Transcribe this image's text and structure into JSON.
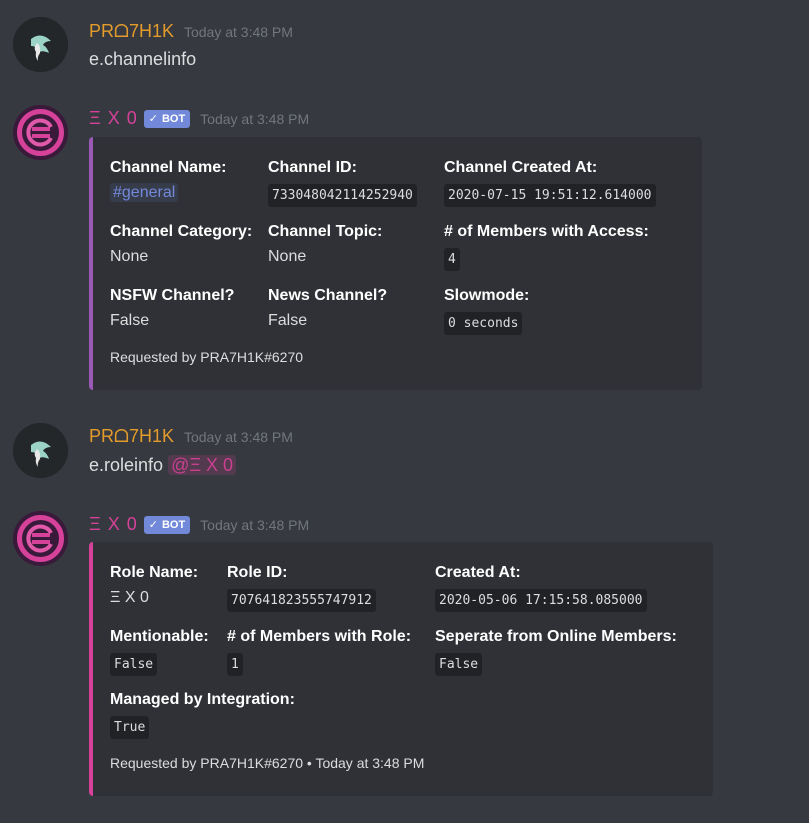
{
  "messages": [
    {
      "author": "PRᴗᴥH1K",
      "author_display": "PRᗝ7H1K",
      "timestamp": "Today at 3:48 PM",
      "content": "e.channelinfo"
    },
    {
      "author": "Ξ X 0",
      "bot_tag": "BOT",
      "timestamp": "Today at 3:48 PM",
      "embed": {
        "fields": [
          {
            "name": "Channel Name:",
            "value": "#general"
          },
          {
            "name": "Channel ID:",
            "value": "733048042114252940"
          },
          {
            "name": "Channel Created At:",
            "value": "2020-07-15 19:51:12.614000"
          },
          {
            "name": "Channel Category:",
            "value": "None"
          },
          {
            "name": "Channel Topic:",
            "value": "None"
          },
          {
            "name": "# of Members with Access:",
            "value": "4"
          },
          {
            "name": "NSFW Channel?",
            "value": "False"
          },
          {
            "name": "News Channel?",
            "value": "False"
          },
          {
            "name": "Slowmode:",
            "value": "0 seconds"
          }
        ],
        "footer": "Requested by PRA7H1K#6270"
      }
    },
    {
      "author_display": "PRᗝ7H1K",
      "timestamp": "Today at 3:48 PM",
      "content": "e.roleinfo",
      "mention": "@Ξ X 0"
    },
    {
      "author": "Ξ X 0",
      "bot_tag": "BOT",
      "timestamp": "Today at 3:48 PM",
      "embed": {
        "fields": [
          {
            "name": "Role Name:",
            "value": "Ξ X 0"
          },
          {
            "name": "Role ID:",
            "value": "707641823555747912"
          },
          {
            "name": "Created At:",
            "value": "2020-05-06 17:15:58.085000"
          },
          {
            "name": "Mentionable:",
            "value": "False"
          },
          {
            "name": "# of Members with Role:",
            "value": "1"
          },
          {
            "name": "Seperate from Online Members:",
            "value": "False"
          },
          {
            "name": "Managed by Integration:",
            "value": "True"
          }
        ],
        "footer": "Requested by PRA7H1K#6270 • Today at 3:48 PM"
      }
    }
  ],
  "colors": {
    "background": "#36393f",
    "embed_bg": "#2f3136",
    "user_name": "#e39c2c",
    "bot_name": "#d6429a",
    "bot_tag": "#7289da",
    "embed1_accent": "#9b59b6",
    "embed2_accent": "#d6429a"
  },
  "icons": [
    "user-avatar-icon",
    "bot-avatar-icon",
    "checkmark-icon"
  ]
}
